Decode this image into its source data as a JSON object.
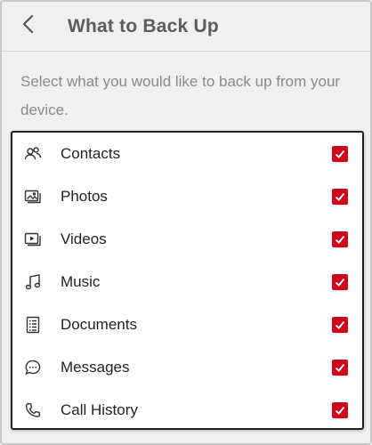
{
  "header": {
    "title": "What to Back Up",
    "back_icon": "chevron-left-icon"
  },
  "description": "Select what you would like to back up from your device.",
  "accent_color": "#d0021b",
  "items": [
    {
      "label": "Contacts",
      "icon": "contacts-icon",
      "checked": true
    },
    {
      "label": "Photos",
      "icon": "photos-icon",
      "checked": true
    },
    {
      "label": "Videos",
      "icon": "videos-icon",
      "checked": true
    },
    {
      "label": "Music",
      "icon": "music-icon",
      "checked": true
    },
    {
      "label": "Documents",
      "icon": "documents-icon",
      "checked": true
    },
    {
      "label": "Messages",
      "icon": "messages-icon",
      "checked": true
    },
    {
      "label": "Call History",
      "icon": "call-history-icon",
      "checked": true
    }
  ]
}
